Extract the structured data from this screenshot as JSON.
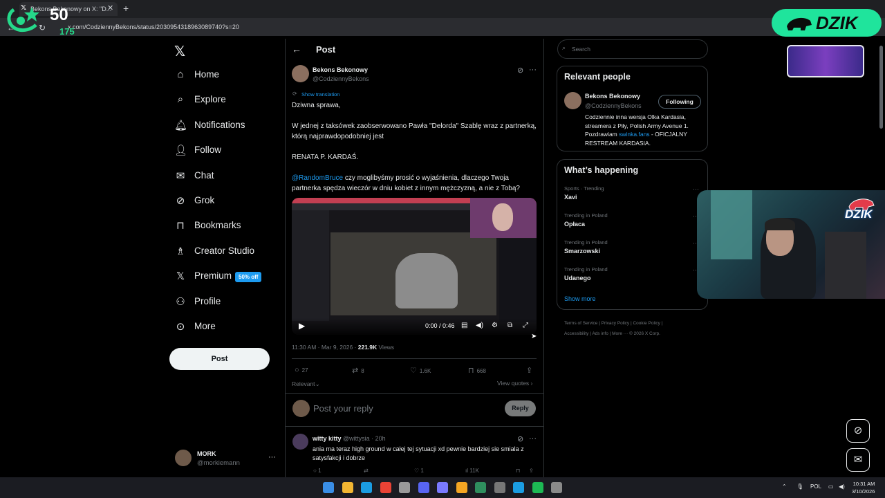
{
  "browser": {
    "tab_title": "Bekons Bekonowy on X: \"D...",
    "url": "x.com/CodziennyBekons/status/2030954318963089740?s=20"
  },
  "overlay": {
    "viewers": "50",
    "viewers_sub": "175",
    "brand": "DZIK",
    "webcam_logo": "DZIK"
  },
  "nav": {
    "items": [
      {
        "label": "Home",
        "icon": "home-icon"
      },
      {
        "label": "Explore",
        "icon": "search-icon"
      },
      {
        "label": "Notifications",
        "icon": "bell-icon"
      },
      {
        "label": "Follow",
        "icon": "add-person-icon"
      },
      {
        "label": "Chat",
        "icon": "mail-icon"
      },
      {
        "label": "Grok",
        "icon": "grok-icon"
      },
      {
        "label": "Bookmarks",
        "icon": "bookmark-icon"
      },
      {
        "label": "Creator Studio",
        "icon": "creator-icon"
      },
      {
        "label": "Premium",
        "icon": "x-icon"
      },
      {
        "label": "Profile",
        "icon": "person-icon"
      },
      {
        "label": "More",
        "icon": "more-circle-icon"
      }
    ],
    "premium_badge": "50% off",
    "post_button": "Post",
    "account_name": "MORK",
    "account_handle": "@morkiemann"
  },
  "post": {
    "header_title": "Post",
    "author_name": "Bekons Bekonowy",
    "author_handle": "@CodziennyBekons",
    "show_translation": "Show translation",
    "line1": "Dziwna sprawa,",
    "line2": "W jednej z taksówek zaobserwowano Pawła \"Delorda\" Szablę wraz z partnerką, którą najprawdopodobniej jest",
    "line3": "RENATA P. KARDAŚ.",
    "mention": "@RandomBruce",
    "line4_rest": " czy moglibyśmy prosić o wyjaśnienia, dlaczego Twoja partnerka spędza wieczór w dniu kobiet z innym mężczyzną, a nie z Tobą?",
    "video_time": "0:00 / 0:46",
    "timestamp": "11:30 AM · Mar 9, 2026 · ",
    "views_count": "221.9K",
    "views_label": " Views",
    "replies": "27",
    "reposts": "8",
    "likes": "1.6K",
    "bookmarks": "668",
    "relevant": "Relevant",
    "view_quotes": "View quotes",
    "reply_placeholder": "Post your reply",
    "reply_button": "Reply"
  },
  "reply": {
    "name": "witty kitty",
    "handle": " @wittysia · 20h",
    "text": "ania ma teraz high ground w całej tej sytuacji xd pewnie bardziej sie smiala z satysfakcji i dobrze",
    "replies": "1",
    "likes": "1",
    "views": "11K"
  },
  "right": {
    "search_placeholder": "Search",
    "relevant_title": "Relevant people",
    "rp_name": "Bekons Bekonowy",
    "rp_handle": "@CodziennyBekons",
    "following": "Following",
    "bio_pre": "Codziennie inna wersja Olka Kardasia, streamera z Piły, Polish Army Avenue 1. Pozdrawiam ",
    "bio_link": "swinka.fans",
    "bio_post": " - OFICJALNY RESTREAM KARDASIA.",
    "happening_title": "What’s happening",
    "trends": [
      {
        "context": "Sports · Trending",
        "name": "Xavi"
      },
      {
        "context": "Trending in Poland",
        "name": "Opłaca"
      },
      {
        "context": "Trending in Poland",
        "name": "Smarzowski"
      },
      {
        "context": "Trending in Poland",
        "name": "Udanego"
      }
    ],
    "show_more": "Show more",
    "footer1": "Terms of Service  |  Privacy Policy  |  Cookie Policy  |",
    "footer2": "Accessibility  |  Ads info  |  More ···  © 2026 X Corp."
  },
  "taskbar": {
    "lang": "POL",
    "time": "10:31 AM",
    "date": "3/10/2026"
  }
}
